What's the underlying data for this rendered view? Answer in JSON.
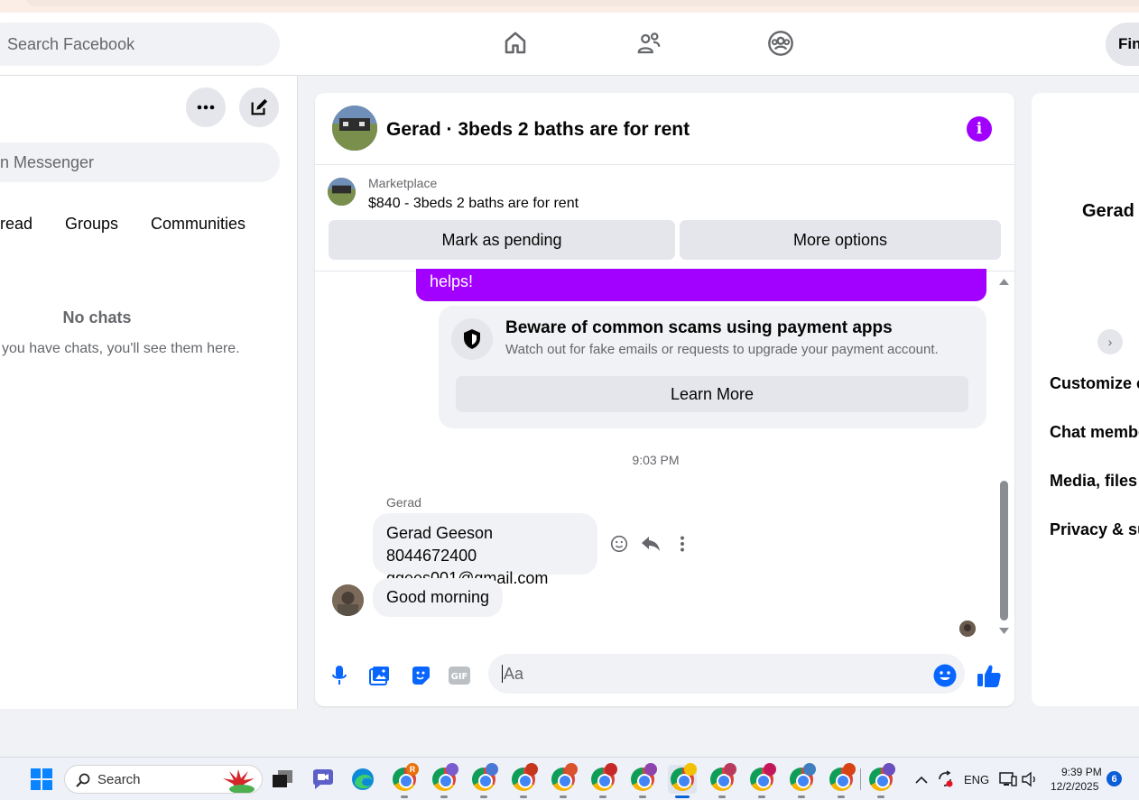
{
  "topbar": {
    "search_placeholder": "Search Facebook",
    "find_label": "Fin"
  },
  "sidebar": {
    "search_placeholder": "n Messenger",
    "filters": [
      "read",
      "Groups",
      "Communities"
    ],
    "empty_title": "No chats",
    "empty_subtitle": "you have chats, you'll see them here."
  },
  "chat": {
    "title": "Gerad · 3beds 2 baths are for rent",
    "marketplace_label": "Marketplace",
    "listing": "$840 - 3beds 2 baths are for rent",
    "mark_pending": "Mark as pending",
    "more_options": "More options",
    "outgoing_tail": "helps!",
    "scam_title": "Beware of common scams using payment apps",
    "scam_text": "Watch out for fake emails or requests to upgrade your payment account.",
    "learn_more": "Learn More",
    "timestamp": "9:03 PM",
    "sender": "Gerad",
    "msg1_line1": "Gerad Geeson 8044672400",
    "msg1_line2": "ggees001@gmail.com",
    "msg2": "Good morning",
    "composer_placeholder": "Aa"
  },
  "right_panel": {
    "name": "Gerad",
    "items": [
      "Customize c",
      "Chat membe",
      "Media, files",
      "Privacy & su"
    ]
  },
  "taskbar": {
    "search_label": "Search",
    "lang": "ENG",
    "time": "9:39 PM",
    "date": "12/2/2025",
    "notif_count": "6"
  },
  "colors": {
    "accent": "#a200ff",
    "fb_blue": "#0866ff"
  }
}
